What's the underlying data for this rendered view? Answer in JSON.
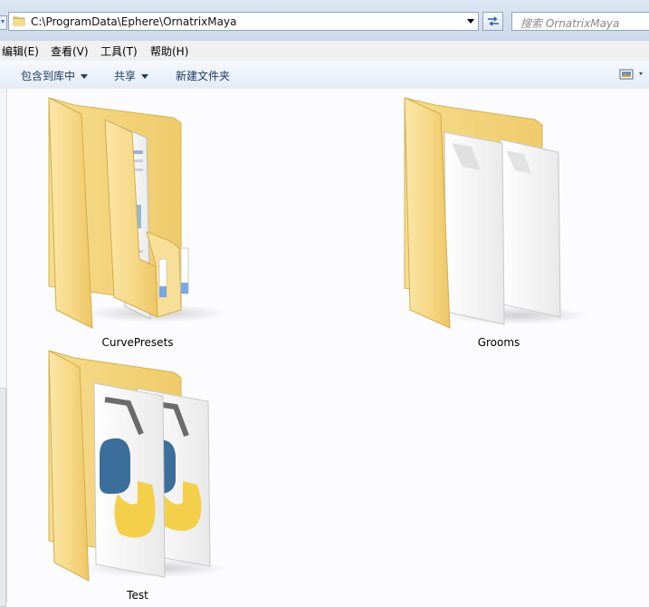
{
  "address_bar": {
    "path": "C:\\ProgramData\\Ephere\\OrnatrixMaya"
  },
  "search": {
    "placeholder": "搜索 OrnatrixMaya"
  },
  "menu": {
    "items": [
      {
        "label": "编辑(E)"
      },
      {
        "label": "查看(V)"
      },
      {
        "label": "工具(T)"
      },
      {
        "label": "帮助(H)"
      }
    ]
  },
  "toolbar": {
    "include_library": "包含到库中",
    "share": "共享",
    "new_folder": "新建文件夹"
  },
  "folders": [
    {
      "name": "CurvePresets",
      "icon": "folder-documents-icon"
    },
    {
      "name": "Grooms",
      "icon": "folder-blank-files-icon"
    },
    {
      "name": "Test",
      "icon": "folder-python-files-icon"
    }
  ],
  "colors": {
    "folder": "#f2d27a",
    "accent": "#3a6fb3",
    "python_blue": "#3c6e9c",
    "python_yellow": "#f4cf4a"
  }
}
